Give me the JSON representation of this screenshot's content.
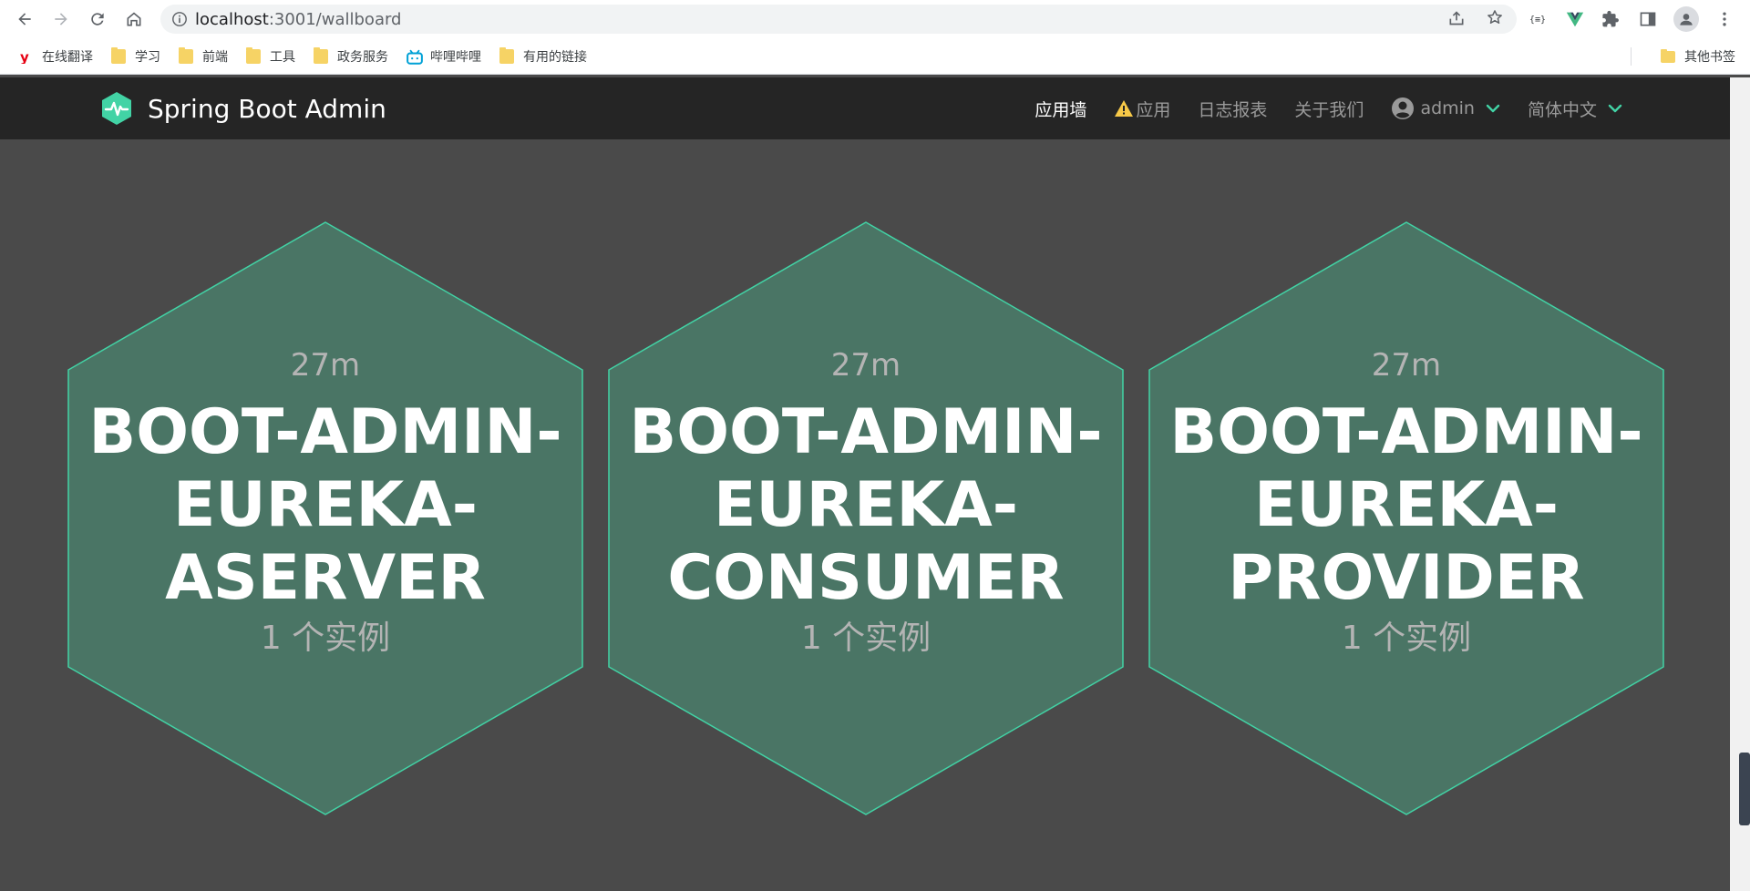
{
  "browser": {
    "url_host": "localhost",
    "url_rest": ":3001/wallboard",
    "bookmarks": [
      {
        "label": "在线翻译",
        "icon": "youdao-icon"
      },
      {
        "label": "学习",
        "icon": "folder-icon"
      },
      {
        "label": "前端",
        "icon": "folder-icon"
      },
      {
        "label": "工具",
        "icon": "folder-icon"
      },
      {
        "label": "政务服务",
        "icon": "folder-icon"
      },
      {
        "label": "哔哩哔哩",
        "icon": "bilibili-icon"
      },
      {
        "label": "有用的链接",
        "icon": "folder-icon"
      }
    ],
    "other_bookmarks": "其他书签"
  },
  "app": {
    "brand": "Spring Boot Admin",
    "nav": {
      "wallboard": "应用墙",
      "applications": "应用",
      "journal": "日志报表",
      "about": "关于我们",
      "user": "admin",
      "language": "简体中文"
    },
    "colors": {
      "accent": "#42d3a5",
      "hex_fill": "#4a7565",
      "background": "#4a4a4a",
      "navbar": "#252525"
    }
  },
  "applications": [
    {
      "time": "27m",
      "name_lines": [
        "BOOT-ADMIN-",
        "EUREKA-",
        "ASERVER"
      ],
      "instances": "1 个实例"
    },
    {
      "time": "27m",
      "name_lines": [
        "BOOT-ADMIN-",
        "EUREKA-",
        "CONSUMER"
      ],
      "instances": "1 个实例"
    },
    {
      "time": "27m",
      "name_lines": [
        "BOOT-ADMIN-",
        "EUREKA-",
        "PROVIDER"
      ],
      "instances": "1 个实例"
    }
  ]
}
